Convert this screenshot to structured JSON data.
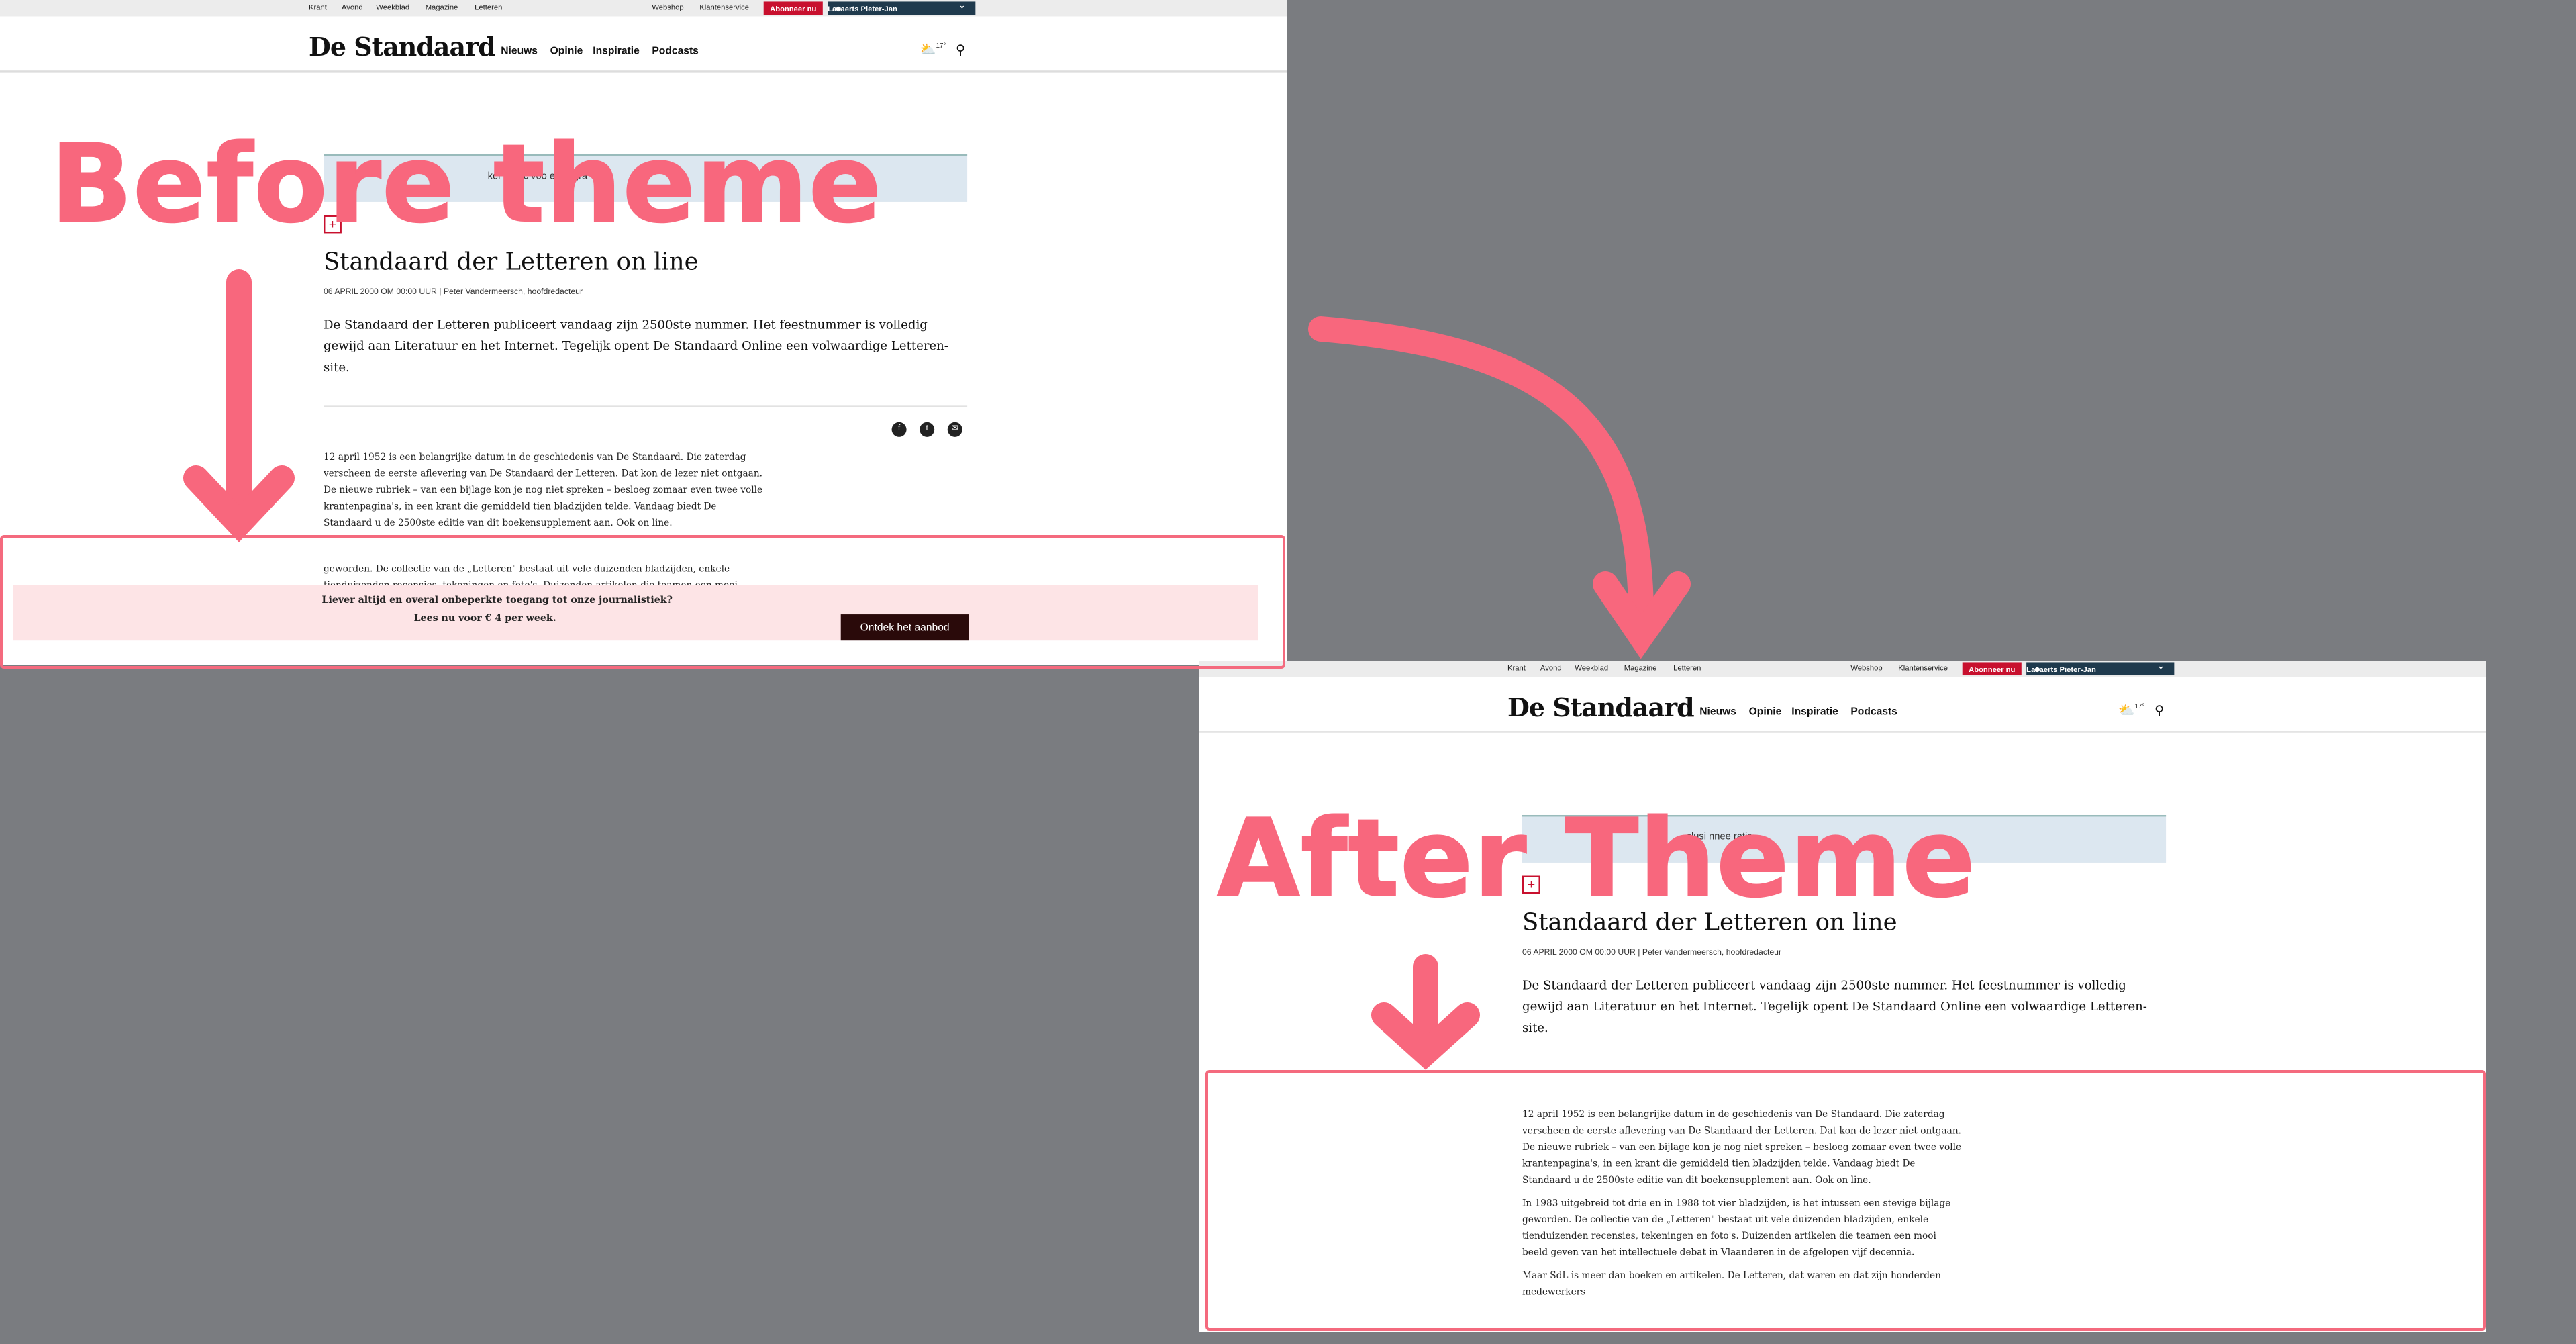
{
  "topbar": {
    "links": [
      "Krant",
      "Avond",
      "Weekblad",
      "Magazine",
      "Letteren"
    ],
    "webshop": "Webshop",
    "service": "Klantenservice",
    "subscribe": "Abonneer nu",
    "user": "Lavaerts Pieter-Jan"
  },
  "header": {
    "logo": "De Standaard",
    "nav": [
      "Nieuws",
      "Opinie",
      "Inspiratie",
      "Podcasts"
    ],
    "temperature": "17°"
  },
  "article": {
    "banner_before": "kel is exc           voo                ee            w                gra",
    "banner_after": "                       clusi          nnee                                  ratis",
    "title": "Standaard der Letteren on line",
    "byline": "06 APRIL 2000 OM 00:00 UUR | Peter Vandermeersch, hoofdredacteur",
    "lead": [
      "De Standaard der Letteren publiceert vandaag zijn 2500ste nummer. Het feestnummer is volledig",
      "gewijd aan Literatuur en het Internet. Tegelijk opent De Standaard Online een volwaardige Letteren-",
      "site."
    ],
    "p1": [
      "12 april 1952 is een belangrijke datum in de geschiedenis van De Standaard. Die zaterdag",
      "verscheen de eerste aflevering van De Standaard der Letteren. Dat kon de lezer niet ontgaan.",
      "De nieuwe rubriek – van een bijlage kon je nog niet spreken – besloeg zomaar even twee volle",
      "krantenpagina's, in een krant die gemiddeld tien bladzijden telde. Vandaag biedt De",
      "Standaard u de 2500ste editie van dit boekensupplement aan. Ook on line."
    ],
    "p2": [
      "In 1983 uitgebreid tot drie en in 1988 tot vier bladzijden, is het intussen een stevige bijlage",
      "geworden. De collectie van de „Letteren\" bestaat uit vele duizenden bladzijden, enkele",
      "tienduizenden recensies, tekeningen en foto's. Duizenden artikelen die teamen een mooi",
      "beeld geven van het intellectuele debat in Vlaanderen in de afgelopen vijf decennia."
    ],
    "p3": [
      "Maar SdL is meer dan boeken en artikelen. De Letteren, dat waren en dat zijn honderden",
      "medewerkers                                          "
    ],
    "truncated_before": [
      "geworden. De collectie van de „Letteren\" bestaat uit vele duizenden bladzijden, enkele",
      "tienduizenden recensies, tekeningen en foto's. Duizenden artikelen die teamen een mooi"
    ]
  },
  "paywall": {
    "question": "Liever altijd en overal onbeperkte toegang tot onze journalistiek?",
    "price": "Lees nu voor € 4 per week.",
    "button": "Ontdek het aanbod"
  },
  "annotations": {
    "before": "Before theme",
    "after": "After Theme"
  },
  "colors": {
    "annotation": "#f8677d",
    "background": "#7a7c80",
    "subscribe": "#c8102e",
    "user_bar": "#1f3a4d",
    "paywall": "#fde4e6",
    "banner": "#dce7f0"
  }
}
